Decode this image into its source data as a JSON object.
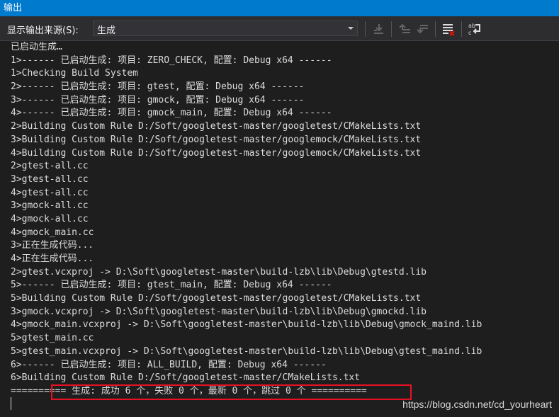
{
  "window": {
    "title": "输出"
  },
  "toolbar": {
    "source_label": "显示输出来源(S):",
    "source_value": "生成",
    "buttons": [
      {
        "icon": "find-message-in-code-icon",
        "enabled": false
      },
      {
        "icon": "previous-message-icon",
        "enabled": false
      },
      {
        "icon": "next-message-icon",
        "enabled": false
      },
      {
        "icon": "clear-all-icon",
        "enabled": true
      },
      {
        "icon": "toggle-word-wrap-icon",
        "enabled": true
      }
    ]
  },
  "output": {
    "lines": [
      "已启动生成…",
      "1>------ 已启动生成: 项目: ZERO_CHECK, 配置: Debug x64 ------",
      "1>Checking Build System",
      "2>------ 已启动生成: 项目: gtest, 配置: Debug x64 ------",
      "3>------ 已启动生成: 项目: gmock, 配置: Debug x64 ------",
      "4>------ 已启动生成: 项目: gmock_main, 配置: Debug x64 ------",
      "2>Building Custom Rule D:/Soft/googletest-master/googletest/CMakeLists.txt",
      "3>Building Custom Rule D:/Soft/googletest-master/googlemock/CMakeLists.txt",
      "4>Building Custom Rule D:/Soft/googletest-master/googlemock/CMakeLists.txt",
      "2>gtest-all.cc",
      "3>gtest-all.cc",
      "4>gtest-all.cc",
      "3>gmock-all.cc",
      "4>gmock-all.cc",
      "4>gmock_main.cc",
      "3>正在生成代码...",
      "4>正在生成代码...",
      "2>gtest.vcxproj -> D:\\Soft\\googletest-master\\build-lzb\\lib\\Debug\\gtestd.lib",
      "5>------ 已启动生成: 项目: gtest_main, 配置: Debug x64 ------",
      "5>Building Custom Rule D:/Soft/googletest-master/googletest/CMakeLists.txt",
      "3>gmock.vcxproj -> D:\\Soft\\googletest-master\\build-lzb\\lib\\Debug\\gmockd.lib",
      "4>gmock_main.vcxproj -> D:\\Soft\\googletest-master\\build-lzb\\lib\\Debug\\gmock_maind.lib",
      "5>gtest_main.cc",
      "5>gtest_main.vcxproj -> D:\\Soft\\googletest-master\\build-lzb\\lib\\Debug\\gtest_maind.lib",
      "6>------ 已启动生成: 项目: ALL_BUILD, 配置: Debug x64 ------",
      "6>Building Custom Rule D:/Soft/googletest-master/CMakeLists.txt",
      "========== 生成: 成功 6 个，失败 0 个，最新 0 个，跳过 0 个 =========="
    ],
    "highlighted_line_index": 26,
    "highlight_color": "#e81123"
  },
  "watermark": "https://blog.csdn.net/cd_yourheart",
  "colors": {
    "title_bar": "#007acc",
    "toolbar": "#2d2d30",
    "output_bg": "#1e1e1e",
    "text": "#dcdcdc"
  }
}
